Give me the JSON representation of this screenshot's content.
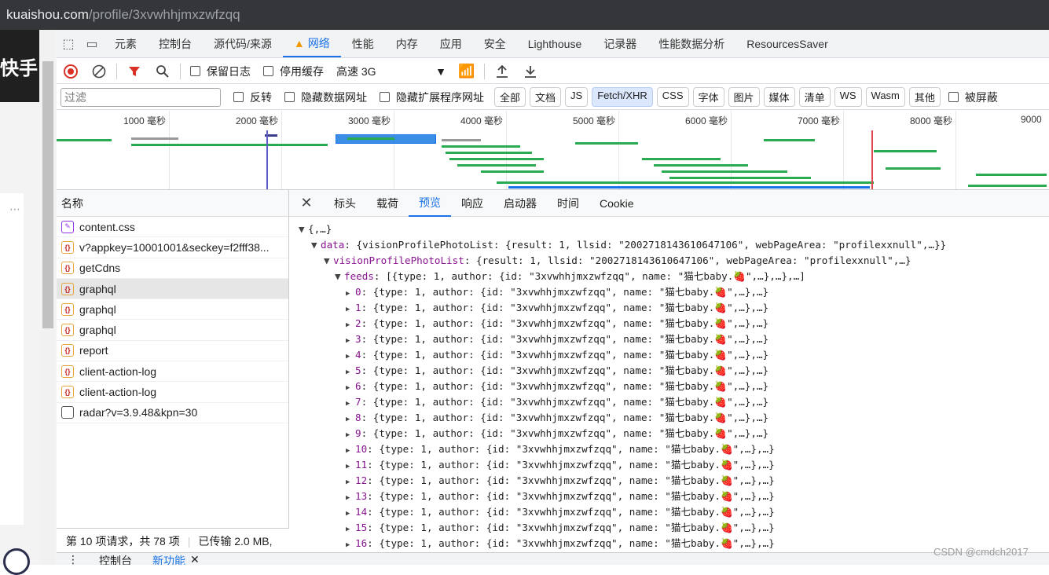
{
  "url": {
    "host": "kuaishou.com",
    "path": "/profile/3xvwhhjmxzwfzqq"
  },
  "page": {
    "logo_text": "快手",
    "dots": "⋯"
  },
  "devtools": {
    "tabs": [
      "元素",
      "控制台",
      "源代码/来源",
      "网络",
      "性能",
      "内存",
      "应用",
      "安全",
      "Lighthouse",
      "记录器",
      "性能数据分析",
      "ResourcesSaver"
    ],
    "active_tab": "网络",
    "toolbar": {
      "preserve_log": "保留日志",
      "disable_cache": "停用缓存",
      "throttle": "高速 3G"
    },
    "filter": {
      "placeholder": "过滤",
      "invert": "反转",
      "hide_data_urls": "隐藏数据网址",
      "hide_extension_urls": "隐藏扩展程序网址",
      "types": [
        "全部",
        "文档",
        "JS",
        "Fetch/XHR",
        "CSS",
        "字体",
        "图片",
        "媒体",
        "清单",
        "WS",
        "Wasm",
        "其他"
      ],
      "selected_type": "Fetch/XHR",
      "blocked": "被屏蔽"
    },
    "timeline_ticks": [
      "1000 毫秒",
      "2000 毫秒",
      "3000 毫秒",
      "4000 毫秒",
      "5000 毫秒",
      "6000 毫秒",
      "7000 毫秒",
      "8000 毫秒",
      "9000"
    ],
    "requests_header": "名称",
    "requests": [
      {
        "name": "content.css",
        "type": "css"
      },
      {
        "name": "v?appkey=10001001&seckey=f2fff38...",
        "type": "xhr"
      },
      {
        "name": "getCdns",
        "type": "xhr"
      },
      {
        "name": "graphql",
        "type": "xhr",
        "selected": true
      },
      {
        "name": "graphql",
        "type": "xhr"
      },
      {
        "name": "graphql",
        "type": "xhr"
      },
      {
        "name": "report",
        "type": "xhr"
      },
      {
        "name": "client-action-log",
        "type": "xhr"
      },
      {
        "name": "client-action-log",
        "type": "xhr"
      },
      {
        "name": "radar?v=3.9.48&kpn=30",
        "type": "doc"
      }
    ],
    "status": {
      "requests": "第 10 项请求，共 78 项",
      "transferred": "已传输 2.0 MB,"
    },
    "panel_tabs": [
      "标头",
      "载荷",
      "预览",
      "响应",
      "启动器",
      "时间",
      "Cookie"
    ],
    "active_panel_tab": "预览",
    "preview": {
      "root": "{,…}",
      "data_line": {
        "key": "data",
        "value": "{visionProfilePhotoList: {result: 1, llsid: \"2002718143610647106\", webPageArea: \"profilexxnull\",…}}"
      },
      "vppl_line": {
        "key": "visionProfilePhotoList",
        "value": "{result: 1, llsid: \"2002718143610647106\", webPageArea: \"profilexxnull\",…}"
      },
      "feeds_line": {
        "key": "feeds",
        "value": "[{type: 1, author: {id: \"3xvwhhjmxzwfzqq\", name: \"猫七baby.🍓\",…},…},…]"
      },
      "feed_items": [
        {
          "index": "0",
          "value": "{type: 1, author: {id: \"3xvwhhjmxzwfzqq\", name: \"猫七baby.🍓\",…},…}"
        },
        {
          "index": "1",
          "value": "{type: 1, author: {id: \"3xvwhhjmxzwfzqq\", name: \"猫七baby.🍓\",…},…}"
        },
        {
          "index": "2",
          "value": "{type: 1, author: {id: \"3xvwhhjmxzwfzqq\", name: \"猫七baby.🍓\",…},…}"
        },
        {
          "index": "3",
          "value": "{type: 1, author: {id: \"3xvwhhjmxzwfzqq\", name: \"猫七baby.🍓\",…},…}"
        },
        {
          "index": "4",
          "value": "{type: 1, author: {id: \"3xvwhhjmxzwfzqq\", name: \"猫七baby.🍓\",…},…}"
        },
        {
          "index": "5",
          "value": "{type: 1, author: {id: \"3xvwhhjmxzwfzqq\", name: \"猫七baby.🍓\",…},…}"
        },
        {
          "index": "6",
          "value": "{type: 1, author: {id: \"3xvwhhjmxzwfzqq\", name: \"猫七baby.🍓\",…},…}"
        },
        {
          "index": "7",
          "value": "{type: 1, author: {id: \"3xvwhhjmxzwfzqq\", name: \"猫七baby.🍓\",…},…}"
        },
        {
          "index": "8",
          "value": "{type: 1, author: {id: \"3xvwhhjmxzwfzqq\", name: \"猫七baby.🍓\",…},…}"
        },
        {
          "index": "9",
          "value": "{type: 1, author: {id: \"3xvwhhjmxzwfzqq\", name: \"猫七baby.🍓\",…},…}"
        },
        {
          "index": "10",
          "value": "{type: 1, author: {id: \"3xvwhhjmxzwfzqq\", name: \"猫七baby.🍓\",…},…}"
        },
        {
          "index": "11",
          "value": "{type: 1, author: {id: \"3xvwhhjmxzwfzqq\", name: \"猫七baby.🍓\",…},…}"
        },
        {
          "index": "12",
          "value": "{type: 1, author: {id: \"3xvwhhjmxzwfzqq\", name: \"猫七baby.🍓\",…},…}"
        },
        {
          "index": "13",
          "value": "{type: 1, author: {id: \"3xvwhhjmxzwfzqq\", name: \"猫七baby.🍓\",…},…}"
        },
        {
          "index": "14",
          "value": "{type: 1, author: {id: \"3xvwhhjmxzwfzqq\", name: \"猫七baby.🍓\",…},…}"
        },
        {
          "index": "15",
          "value": "{type: 1, author: {id: \"3xvwhhjmxzwfzqq\", name: \"猫七baby.🍓\",…},…}"
        },
        {
          "index": "16",
          "value": "{type: 1, author: {id: \"3xvwhhjmxzwfzqq\", name: \"猫七baby.🍓\",…},…}"
        }
      ]
    },
    "drawer": {
      "console": "控制台",
      "whats_new": "新功能"
    }
  },
  "watermark": "CSDN @cmdch2017",
  "colors": {
    "accent": "#1a73e8",
    "record": "#d93025",
    "json_key": "#881391",
    "json_string": "#1a1aa6"
  }
}
